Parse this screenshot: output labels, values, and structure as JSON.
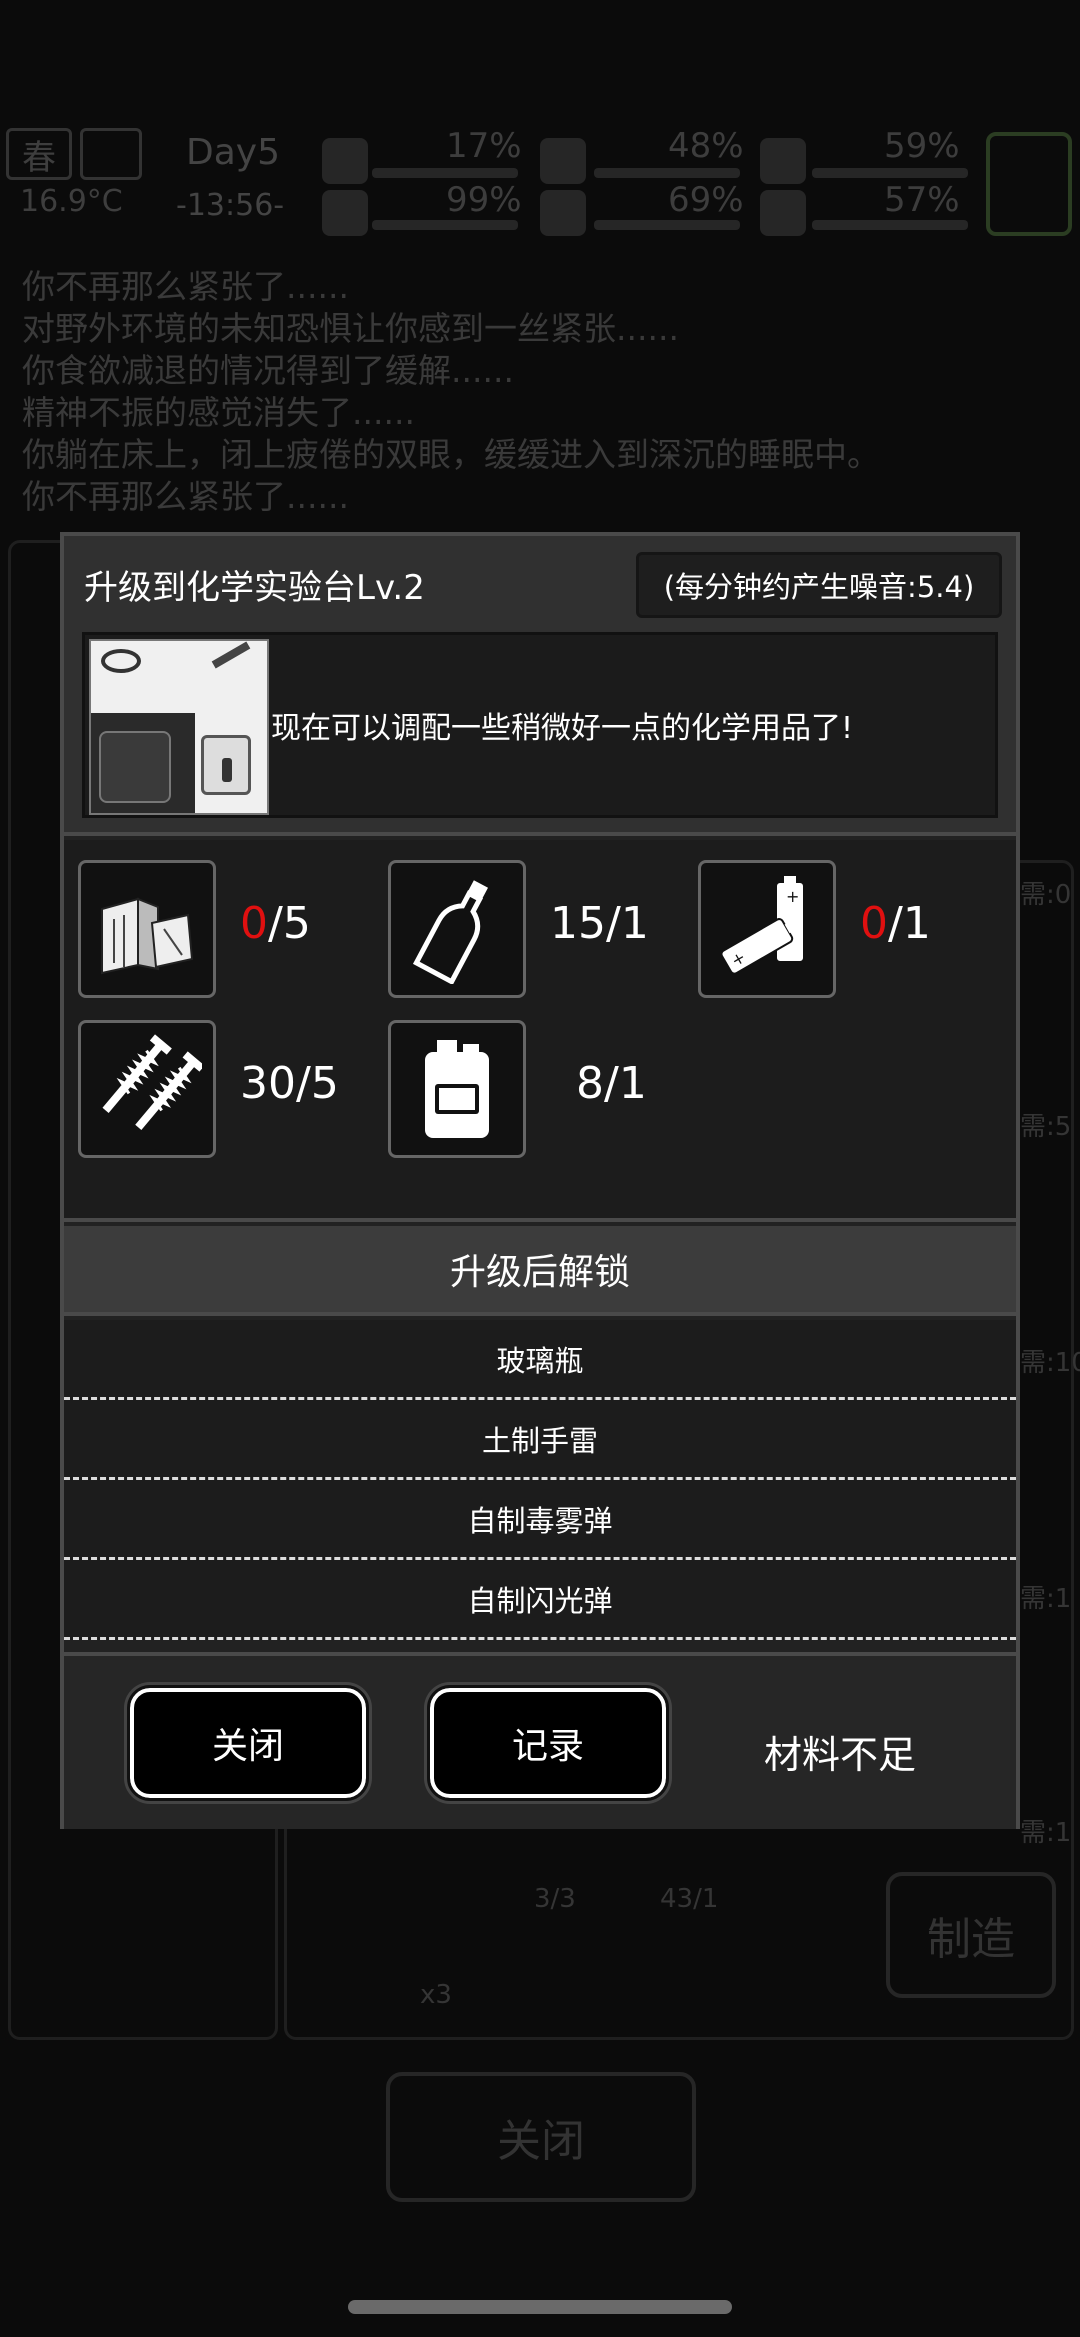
{
  "hud": {
    "season": "春",
    "temperature": "16.9°C",
    "day": "Day5",
    "time": "-13:56-",
    "stats": [
      {
        "value": "17%",
        "icon": "alarm-icon"
      },
      {
        "value": "48%",
        "icon": "stomach-icon"
      },
      {
        "value": "59%",
        "icon": "battery-icon"
      },
      {
        "value": "99%",
        "icon": "boot-icon"
      },
      {
        "value": "69%",
        "icon": "water-drop-icon"
      },
      {
        "value": "57%",
        "icon": "heart-icon"
      }
    ]
  },
  "log": [
    "你不再那么紧张了......",
    "对野外环境的未知恐惧让你感到一丝紧张......",
    "你食欲减退的情况得到了缓解......",
    "精神不振的感觉消失了......",
    "你躺在床上，闭上疲倦的双眼，缓缓进入到深沉的睡眠中。",
    "你不再那么紧张了......"
  ],
  "background": {
    "close_label": "关闭",
    "make_label": "制造",
    "side_texts": [
      "需:0",
      "需:5",
      "需:10",
      "需:1",
      "需:1"
    ],
    "craft_counts": [
      "3/3",
      "43/1"
    ],
    "craft_multiplier": "x3"
  },
  "dialog": {
    "title": "升级到化学实验台Lv.2",
    "noise": "(每分钟约产生噪音:5.4)",
    "description": "现在可以调配一些稍微好一点的化学用品了!",
    "materials": [
      {
        "icon": "wood-planks-icon",
        "have": "0",
        "need": "/5",
        "insufficient": true
      },
      {
        "icon": "bottle-icon",
        "have": "15",
        "need": "/1",
        "insufficient": false
      },
      {
        "icon": "batteries-icon",
        "have": "0",
        "need": "/1",
        "insufficient": true
      },
      {
        "icon": "screws-icon",
        "have": "30",
        "need": "/5",
        "insufficient": false
      },
      {
        "icon": "jerry-can-icon",
        "have": "8",
        "need": "/1",
        "insufficient": false
      }
    ],
    "unlock_header": "升级后解锁",
    "unlocks": [
      "玻璃瓶",
      "土制手雷",
      "自制毒雾弹",
      "自制闪光弹"
    ],
    "close_label": "关闭",
    "record_label": "记录",
    "status": "材料不足"
  },
  "colors": {
    "insufficient": "#e01010",
    "panel": "#222222",
    "border": "#4a4a4a"
  }
}
